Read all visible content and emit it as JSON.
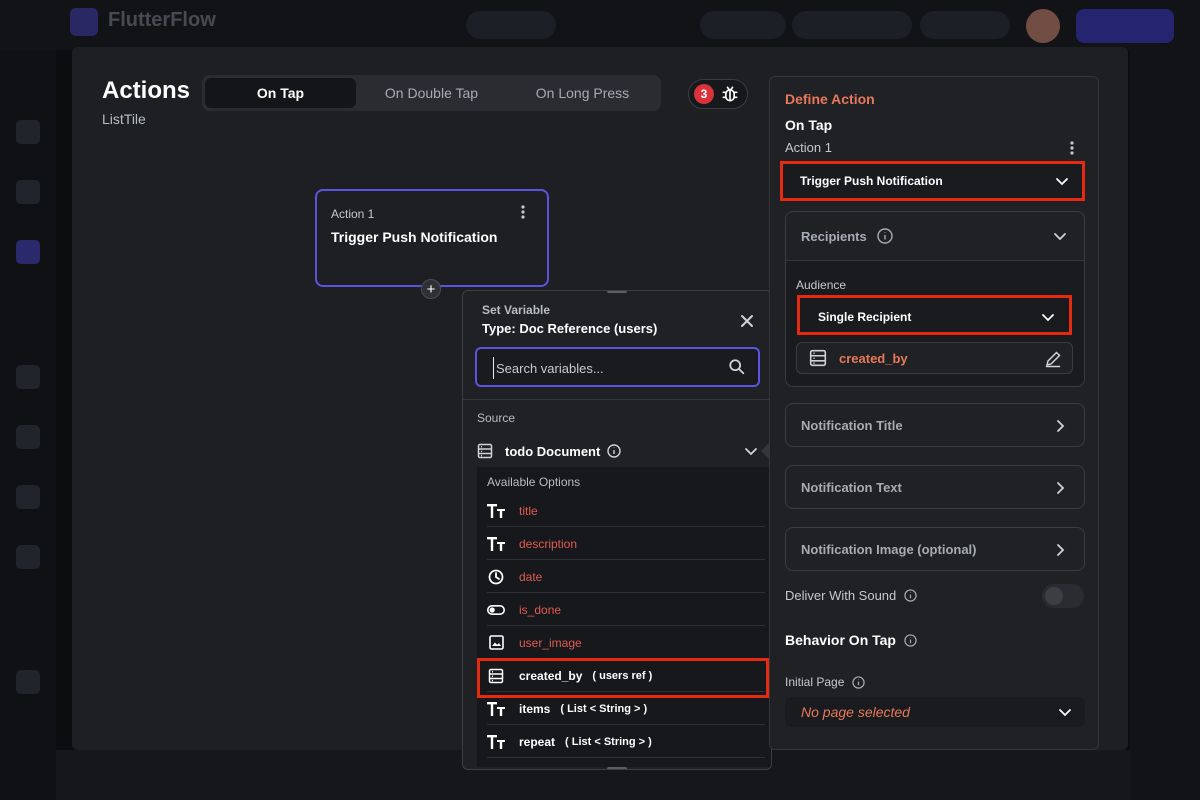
{
  "app": {
    "title": "FlutterFlow"
  },
  "actions_panel": {
    "title": "Actions",
    "subtitle": "ListTile",
    "tabs": [
      {
        "label": "On Tap",
        "active": true
      },
      {
        "label": "On Double Tap",
        "active": false
      },
      {
        "label": "On Long Press",
        "active": false
      }
    ],
    "debug_count": "3"
  },
  "node": {
    "label": "Action 1",
    "title": "Trigger Push Notification"
  },
  "set_variable": {
    "kicker": "Set Variable",
    "title": "Type: Doc Reference (users)",
    "search_placeholder": "Search variables...",
    "source_label": "Source",
    "source_name": "todo Document",
    "available_label": "Available Options",
    "options": [
      {
        "icon": "text-icon",
        "label": "title",
        "type": ""
      },
      {
        "icon": "text-icon",
        "label": "description",
        "type": ""
      },
      {
        "icon": "clock-icon",
        "label": "date",
        "type": ""
      },
      {
        "icon": "toggle-icon",
        "label": "is_done",
        "type": ""
      },
      {
        "icon": "image-icon",
        "label": "user_image",
        "type": ""
      },
      {
        "icon": "database-icon",
        "label": "created_by",
        "type": "( users ref )"
      },
      {
        "icon": "text-icon",
        "label": "items",
        "type": "( List < String > )"
      },
      {
        "icon": "text-icon",
        "label": "repeat",
        "type": "( List < String > )"
      }
    ]
  },
  "define_action": {
    "header": "Define Action",
    "trigger": "On Tap",
    "action_label": "Action 1",
    "action_type": "Trigger Push Notification",
    "recipients_label": "Recipients",
    "audience_label": "Audience",
    "audience_value": "Single Recipient",
    "recipient_ref": "created_by",
    "notification_title": "Notification Title",
    "notification_text": "Notification Text",
    "notification_image": "Notification Image (optional)",
    "deliver_sound_label": "Deliver With Sound",
    "behavior_label": "Behavior On Tap",
    "initial_page_label": "Initial Page",
    "initial_page_value": "No page selected"
  },
  "colors": {
    "accent": "#5a55e0",
    "highlight": "#e62a12",
    "orange": "#e8785a",
    "red_text": "#e05a52"
  }
}
